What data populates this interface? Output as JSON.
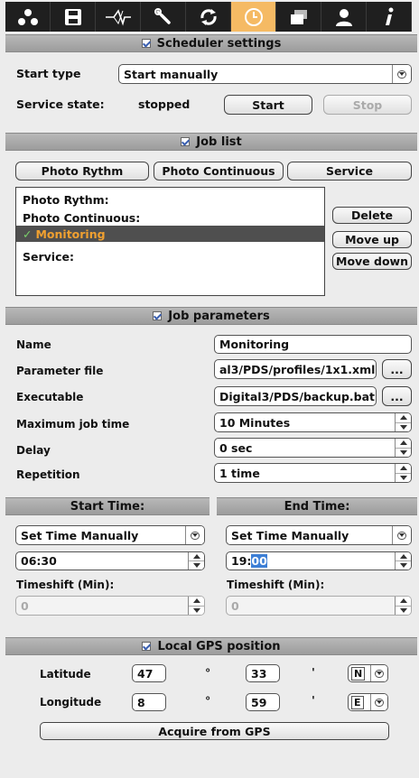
{
  "toolbar": {
    "buttons": [
      {
        "icon": "network-icon"
      },
      {
        "icon": "save-icon"
      },
      {
        "icon": "waveform-icon"
      },
      {
        "icon": "wrench-icon"
      },
      {
        "icon": "refresh-icon"
      },
      {
        "icon": "clock-icon",
        "active": true
      },
      {
        "icon": "windows-icon"
      },
      {
        "icon": "user-icon"
      },
      {
        "icon": "info-icon"
      }
    ],
    "active_color": "#f5ba64"
  },
  "scheduler": {
    "header": "Scheduler settings",
    "start_type_label": "Start type",
    "start_type_value": "Start manually",
    "service_state_label": "Service state:",
    "service_state_value": "stopped",
    "start_button": "Start",
    "stop_button": "Stop"
  },
  "job_list": {
    "header": "Job list",
    "add_buttons": [
      "Photo Rythm",
      "Photo Continuous",
      "Service"
    ],
    "items": [
      {
        "label": "Photo Rythm:"
      },
      {
        "label": "Photo Continuous:"
      },
      {
        "label": "Monitoring",
        "selected": true,
        "check": "✓"
      },
      {
        "label": "Service:"
      }
    ],
    "delete_button": "Delete",
    "move_up_button": "Move up",
    "move_down_button": "Move down",
    "selected_color": "#f0a030"
  },
  "job_params": {
    "header": "Job parameters",
    "name_label": "Name",
    "name_value": "Monitoring",
    "param_file_label": "Parameter file",
    "param_file_value": "al3/PDS/profiles/1x1.xml",
    "executable_label": "Executable",
    "executable_value": "Digital3/PDS/backup.bat",
    "browse_label": "...",
    "max_time_label": "Maximum job time",
    "max_time_value": "10 Minutes",
    "delay_label": "Delay",
    "delay_value": "0 sec",
    "repetition_label": "Repetition",
    "repetition_value": "1 time"
  },
  "time": {
    "start_header": "Start Time:",
    "end_header": "End Time:",
    "start_mode": "Set Time Manually",
    "end_mode": "Set Time Manually",
    "start_time": "06:30",
    "end_time_hours": "19:",
    "end_time_minutes": "00",
    "timeshift_label_start": "Timeshift (Min):",
    "timeshift_label_end": "Timeshift (Min):",
    "timeshift_start": "0",
    "timeshift_end": "0"
  },
  "gps": {
    "header": "Local GPS position",
    "latitude_label": "Latitude",
    "lat_deg": "47",
    "lat_min": "33",
    "lat_dir": "N",
    "longitude_label": "Longitude",
    "lon_deg": "8",
    "lon_min": "59",
    "lon_dir": "E",
    "degree_symbol": "°",
    "minute_symbol": "'",
    "acquire_button": "Acquire from GPS"
  }
}
